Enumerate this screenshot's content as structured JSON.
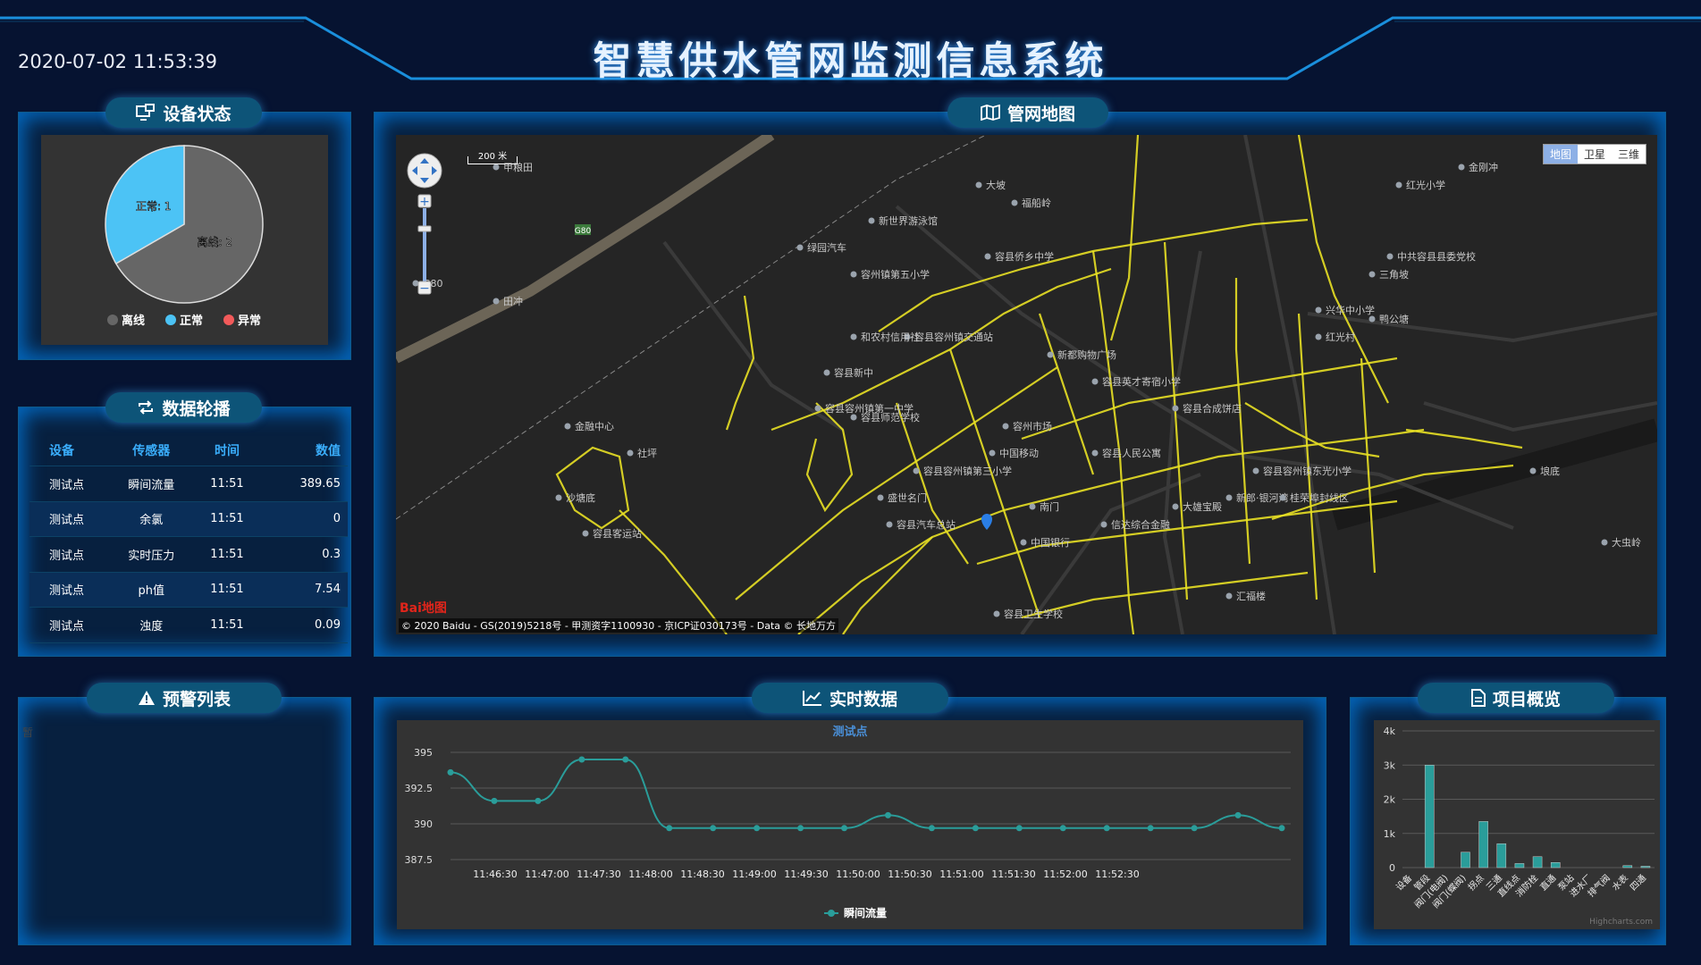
{
  "header": {
    "title": "智慧供水管网监测信息系统",
    "datetime": "2020-07-02 11:53:39"
  },
  "device_status": {
    "title": "设备状态",
    "chart_data": {
      "type": "pie",
      "slices": [
        {
          "label": "离线: 2",
          "value": 2,
          "color": "#666666"
        },
        {
          "label": "正常: 1",
          "value": 1,
          "color": "#4cc3f5"
        }
      ],
      "legend": [
        {
          "name": "离线",
          "color": "#666666"
        },
        {
          "name": "正常",
          "color": "#4cc3f5"
        },
        {
          "name": "异常",
          "color": "#f25a5a"
        }
      ]
    }
  },
  "data_carousel": {
    "title": "数据轮播",
    "columns": [
      "设备",
      "传感器",
      "时间",
      "数值"
    ],
    "rows": [
      [
        "测试点",
        "瞬间流量",
        "11:51",
        "389.65"
      ],
      [
        "测试点",
        "余氯",
        "11:51",
        "0"
      ],
      [
        "测试点",
        "实时压力",
        "11:51",
        "0.3"
      ],
      [
        "测试点",
        "ph值",
        "11:51",
        "7.54"
      ],
      [
        "测试点",
        "浊度",
        "11:51",
        "0.09"
      ]
    ]
  },
  "pipe_map": {
    "title": "管网地图",
    "map_types": [
      "地图",
      "卫星",
      "三维"
    ],
    "scale": "200 米",
    "copyright": "© 2020 Baidu - GS(2019)5218号 - 甲测资字1100930 - 京ICP证030173号 - Data © 长地万方",
    "logo": "Bai地图",
    "labels": [
      "甲粮田",
      "大坡",
      "福船岭",
      "新世界游泳馆",
      "绿园汽车",
      "容州镇第五小学",
      "容县侨乡中学",
      "容县容州镇交通站",
      "新都购物广场",
      "容县新中",
      "容县容州镇第一中学",
      "容县师范学校",
      "容州市场",
      "中国移动",
      "容县人民公寓",
      "容县容州镇东光小学",
      "新郎·银河湾",
      "桂荣埠封线区",
      "大雄宝殿",
      "南门",
      "信达综合金融",
      "中国银行",
      "容县卫生学校",
      "汇福楼",
      "三角坡",
      "兴华中小学",
      "鸭公塘",
      "红光村",
      "中共容县县委党校",
      "红光小学",
      "金刚冲",
      "田冲",
      "社坪",
      "沙塘底",
      "容县客运站",
      "金融中心",
      "G80",
      "和农村信用社",
      "盛世名门",
      "容县汽车总站",
      "容县容州镇第三小学",
      "容县合成饼店",
      "容县英才寄宿小学",
      "埌底",
      "大虫岭"
    ]
  },
  "alerts": {
    "title": "预警列表",
    "placeholder": "暂"
  },
  "realtime": {
    "title": "实时数据",
    "chart_data": {
      "type": "line",
      "title": "测试点",
      "series": [
        {
          "name": "瞬间流量",
          "color": "#2a9d9a",
          "values": [
            393.6,
            391.6,
            391.6,
            394.5,
            394.5,
            389.7,
            389.7,
            389.7,
            389.7,
            389.7,
            390.6,
            389.7,
            389.7,
            389.7,
            389.7,
            389.7,
            389.7,
            389.7,
            390.6,
            389.7
          ]
        }
      ],
      "x_ticks": [
        "11:46:30",
        "11:47:00",
        "11:47:30",
        "11:48:00",
        "11:48:30",
        "11:49:00",
        "11:49:30",
        "11:50:00",
        "11:50:30",
        "11:51:00",
        "11:51:30",
        "11:52:00",
        "11:52:30"
      ],
      "y_ticks": [
        387.5,
        390,
        392.5,
        395
      ],
      "ylim": [
        387.5,
        396
      ]
    }
  },
  "overview": {
    "title": "项目概览",
    "chart_data": {
      "type": "bar",
      "categories": [
        "设备",
        "管段",
        "阀门(电阀)",
        "阀门(蝶阀)",
        "拐点",
        "三通",
        "直线点",
        "消防栓",
        "直通",
        "泵站",
        "进水厂",
        "排气阀",
        "水表",
        "四通"
      ],
      "values": [
        0,
        3000,
        0,
        450,
        1350,
        700,
        120,
        320,
        150,
        0,
        0,
        0,
        60,
        40
      ],
      "y_ticks": [
        "0",
        "1k",
        "2k",
        "3k",
        "4k"
      ],
      "ylim": [
        0,
        4000
      ],
      "credit": "Highcharts.com",
      "color": "#2a9d9a"
    }
  }
}
